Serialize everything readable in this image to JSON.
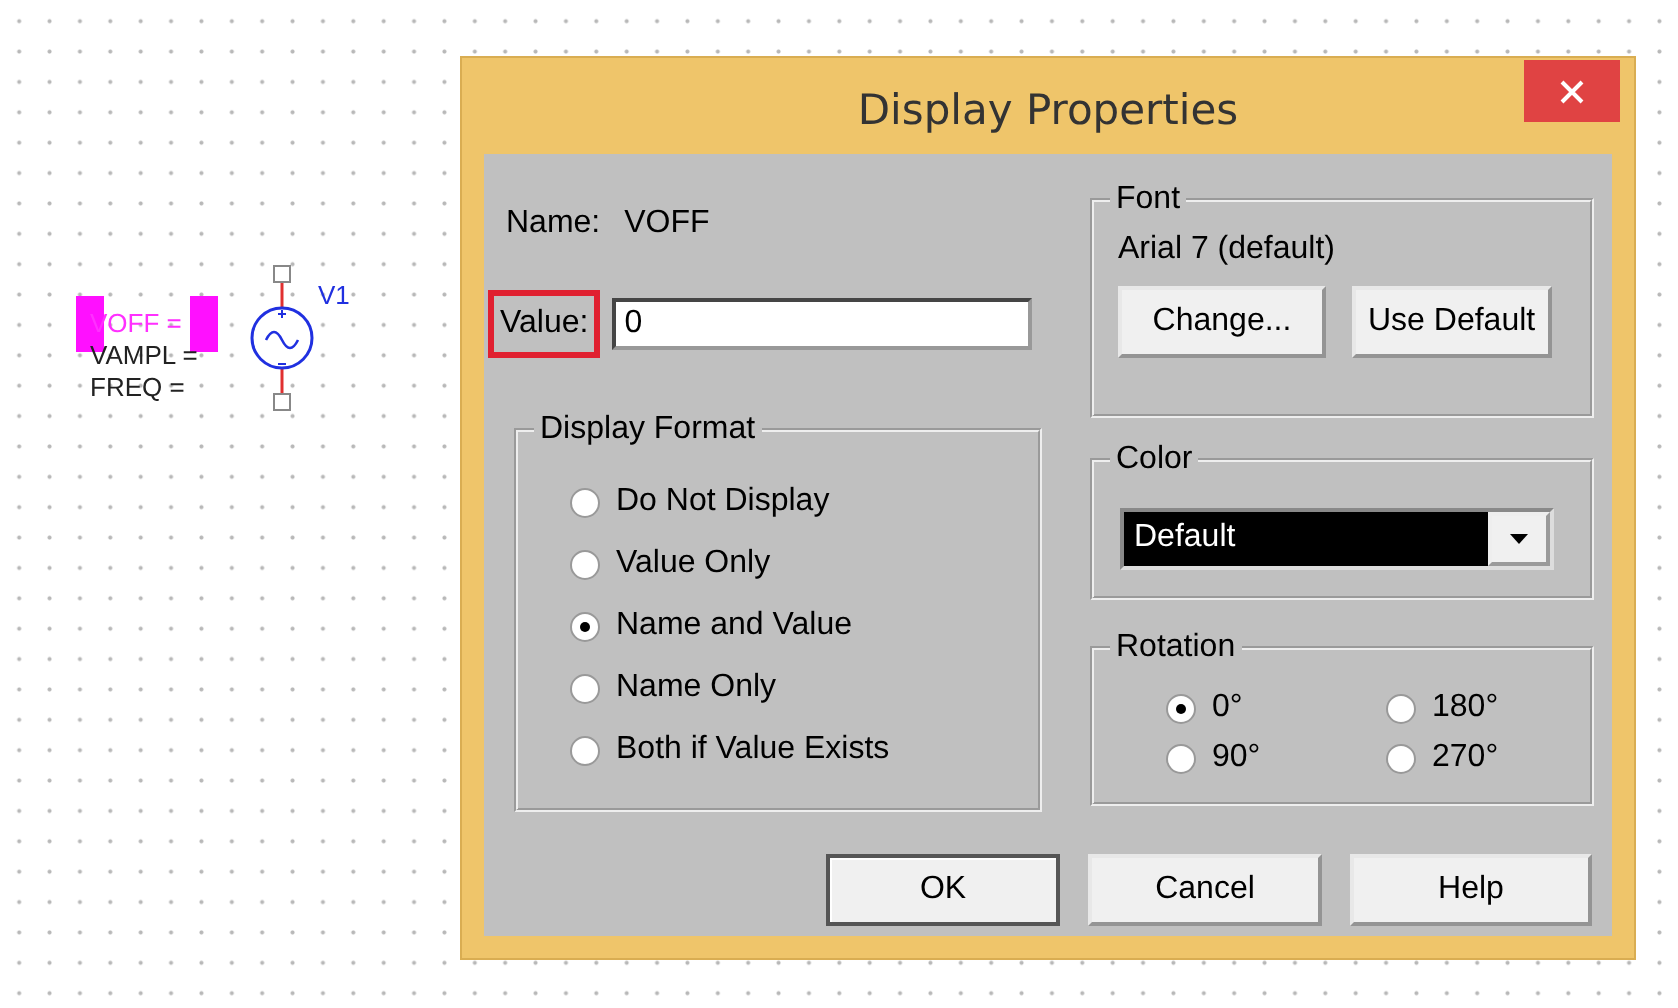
{
  "schematic": {
    "part_label": "V1",
    "params": [
      {
        "text": "VOFF =",
        "selected": true
      },
      {
        "text": "VAMPL =",
        "selected": false
      },
      {
        "text": "FREQ =",
        "selected": false
      }
    ]
  },
  "dialog": {
    "title": "Display Properties",
    "name_label": "Name:",
    "name_value": "VOFF",
    "value_label": "Value:",
    "value_highlighted": true,
    "value": "0",
    "display_format": {
      "title": "Display Format",
      "options": [
        {
          "label": "Do Not Display",
          "selected": false
        },
        {
          "label": "Value Only",
          "selected": false
        },
        {
          "label": "Name and Value",
          "selected": true
        },
        {
          "label": "Name Only",
          "selected": false
        },
        {
          "label": "Both if Value Exists",
          "selected": false
        }
      ]
    },
    "font": {
      "title": "Font",
      "current": "Arial 7 (default)",
      "buttons": [
        "Change...",
        "Use Default"
      ]
    },
    "color": {
      "title": "Color",
      "value": "Default"
    },
    "rotation": {
      "title": "Rotation",
      "options": [
        {
          "label": "0°",
          "selected": true
        },
        {
          "label": "180°",
          "selected": false
        },
        {
          "label": "90°",
          "selected": false
        },
        {
          "label": "270°",
          "selected": false
        }
      ]
    },
    "buttons": [
      {
        "label": "OK",
        "default": true
      },
      {
        "label": "Cancel",
        "default": false
      },
      {
        "label": "Help",
        "default": false
      }
    ]
  }
}
